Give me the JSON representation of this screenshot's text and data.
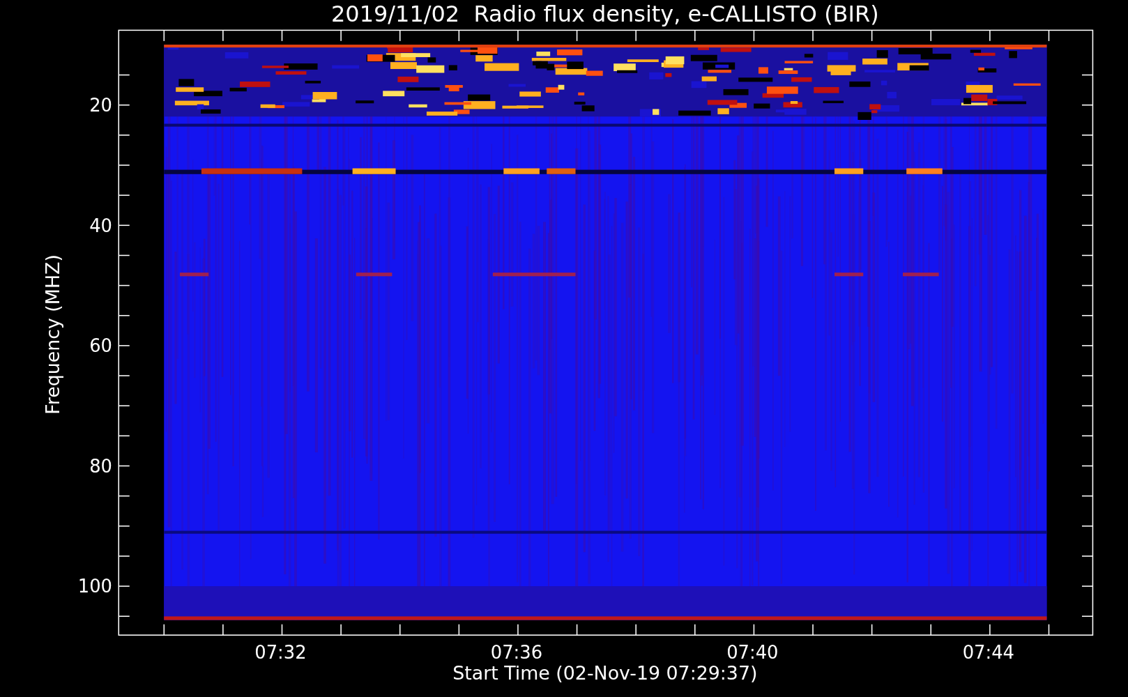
{
  "title": "2019/11/02  Radio flux density, e-CALLISTO (BIR)",
  "ylabel": "Frequency (MHZ)",
  "xlabel": "Start Time (02-Nov-19 07:29:37)",
  "yticks": [
    "20",
    "40",
    "60",
    "80",
    "100"
  ],
  "xticks": [
    "07:32",
    "07:36",
    "07:40",
    "07:44"
  ]
}
